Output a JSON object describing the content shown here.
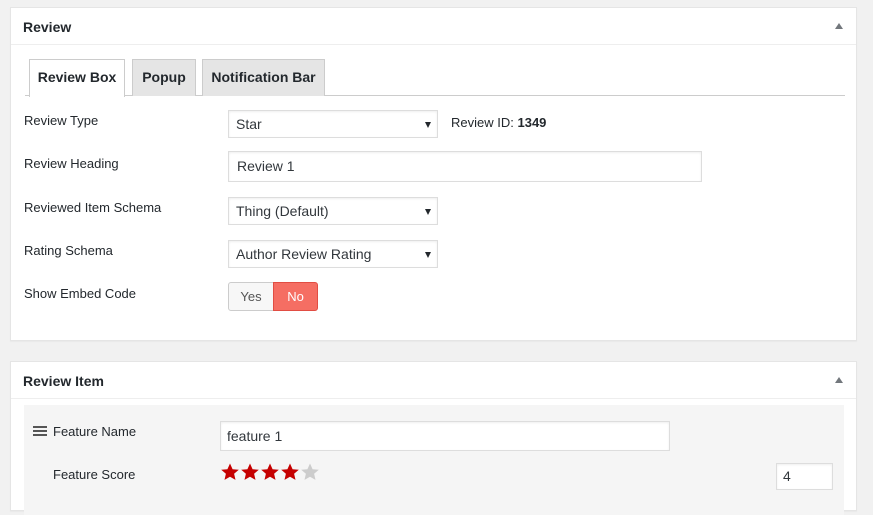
{
  "review_panel": {
    "title": "Review",
    "tabs": [
      {
        "label": "Review Box",
        "active": true
      },
      {
        "label": "Popup",
        "active": false
      },
      {
        "label": "Notification Bar",
        "active": false
      }
    ],
    "review_type": {
      "label": "Review Type",
      "value": "Star"
    },
    "review_id": {
      "label": "Review ID:",
      "value": "1349"
    },
    "review_heading": {
      "label": "Review Heading",
      "value": "Review 1"
    },
    "item_schema": {
      "label": "Reviewed Item Schema",
      "value": "Thing (Default)"
    },
    "rating_schema": {
      "label": "Rating Schema",
      "value": "Author Review Rating"
    },
    "embed_code": {
      "label": "Show Embed Code",
      "yes": "Yes",
      "no": "No",
      "selected": "No"
    }
  },
  "item_panel": {
    "title": "Review Item",
    "feature_name": {
      "label": "Feature Name",
      "value": "feature 1"
    },
    "feature_score": {
      "label": "Feature Score",
      "value": "4",
      "stars_filled": 4,
      "stars_total": 5
    }
  },
  "colors": {
    "star_filled": "#c50000",
    "star_empty": "#cccccc",
    "toggle_active": "#f56e63"
  },
  "icons": {
    "collapse": "triangle-up-icon",
    "drag": "hamburger-drag-icon",
    "star": "star-icon"
  }
}
